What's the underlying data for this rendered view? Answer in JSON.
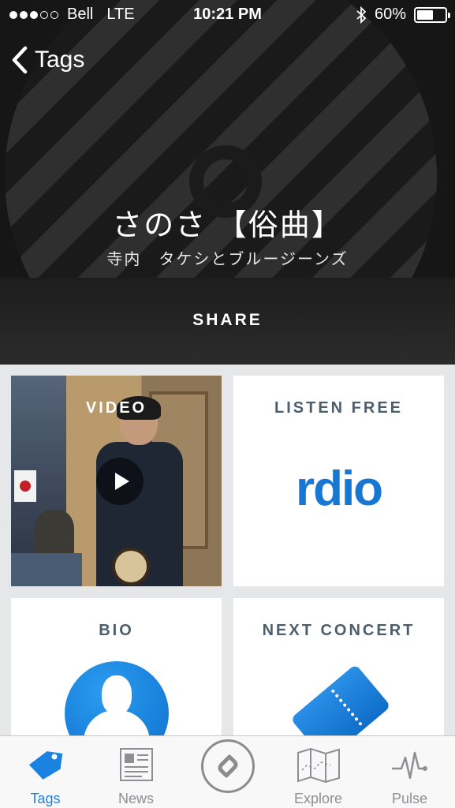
{
  "status_bar": {
    "carrier": "Bell",
    "network": "LTE",
    "time": "10:21 PM",
    "battery": "60%",
    "battery_level": 0.6,
    "signal_bars_filled": 3,
    "signal_bars_total": 5
  },
  "nav": {
    "back_label": "Tags"
  },
  "track": {
    "title": "さのさ 【俗曲】",
    "artist": "寺内　タケシとブルージーンズ"
  },
  "share_label": "SHARE",
  "tiles": {
    "video": {
      "label": "VIDEO"
    },
    "listen": {
      "label": "LISTEN FREE",
      "service": "rdio"
    },
    "bio": {
      "label": "BIO"
    },
    "concert": {
      "label": "NEXT CONCERT"
    }
  },
  "tabs": [
    {
      "label": "Tags",
      "icon": "tag-icon",
      "active": true
    },
    {
      "label": "News",
      "icon": "news-icon",
      "active": false
    },
    {
      "label": "",
      "icon": "shazam-icon",
      "active": false
    },
    {
      "label": "Explore",
      "icon": "map-icon",
      "active": false
    },
    {
      "label": "Pulse",
      "icon": "pulse-icon",
      "active": false
    }
  ],
  "colors": {
    "accent": "#1b82e2",
    "rdio_blue": "#1877d2",
    "tile_label": "#4c5e6c"
  }
}
